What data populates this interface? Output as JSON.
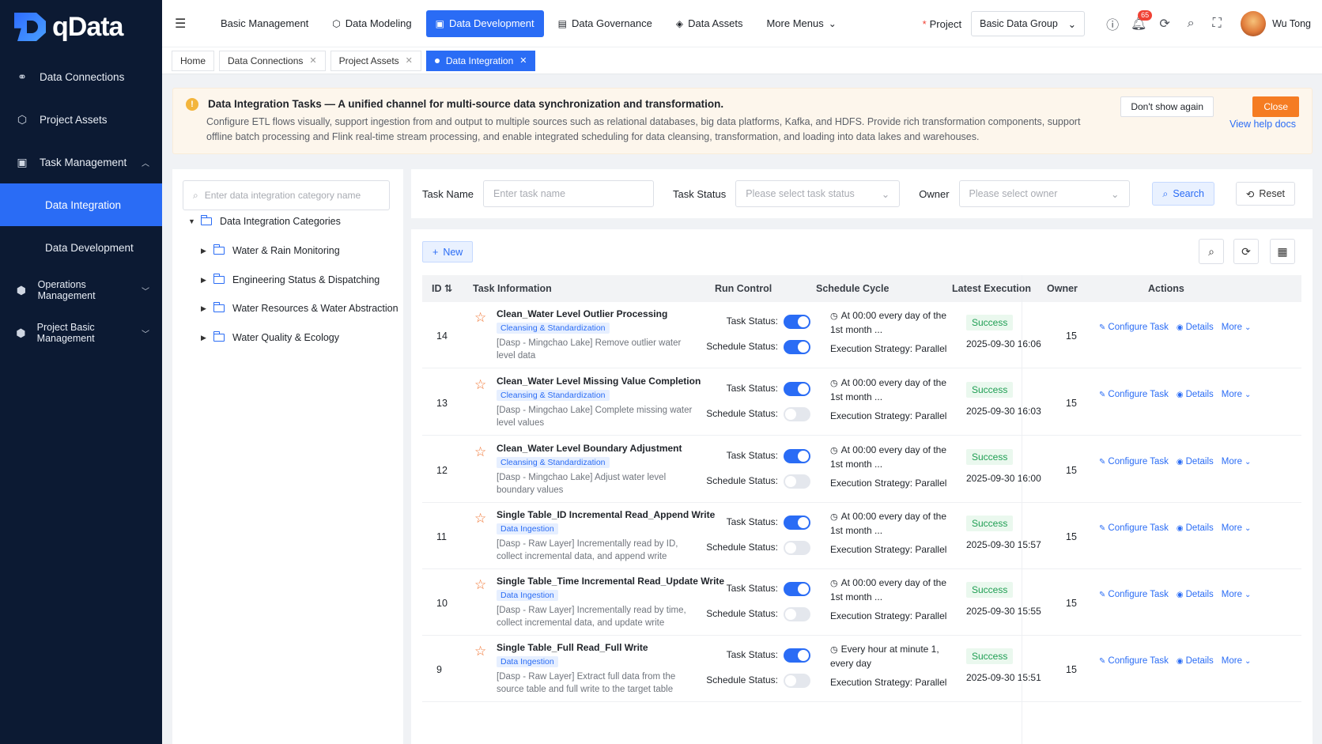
{
  "app": {
    "logo_text": "qData"
  },
  "sidebar": {
    "items": [
      {
        "label": "Data Connections",
        "icon": "connections-icon"
      },
      {
        "label": "Project Assets",
        "icon": "assets-icon"
      },
      {
        "label": "Task Management",
        "icon": "task-icon",
        "expanded": true,
        "children": [
          {
            "label": "Data Integration",
            "active": true
          },
          {
            "label": "Data Development"
          }
        ]
      },
      {
        "label": "Operations Management",
        "icon": "operations-icon"
      },
      {
        "label": "Project Basic Management",
        "icon": "project-icon"
      }
    ]
  },
  "topnav": {
    "items": [
      {
        "label": "Basic Management"
      },
      {
        "label": "Data Modeling",
        "icon": "modeling-icon"
      },
      {
        "label": "Data Development",
        "icon": "development-icon",
        "active": true
      },
      {
        "label": "Data Governance",
        "icon": "governance-icon"
      },
      {
        "label": "Data Assets",
        "icon": "data-assets-icon"
      },
      {
        "label": "More Menus"
      }
    ],
    "project_label": "Project",
    "project_value": "Basic Data Group",
    "notification_count": "65",
    "user_name": "Wu Tong"
  },
  "tabs": [
    {
      "label": "Home"
    },
    {
      "label": "Data Connections"
    },
    {
      "label": "Project Assets"
    },
    {
      "label": "Data Integration",
      "active": true
    }
  ],
  "notice": {
    "title": "Data Integration Tasks — A unified channel for multi-source data synchronization and transformation.",
    "description": "Configure ETL flows visually, support ingestion from and output to multiple sources such as relational databases, big data platforms, Kafka, and HDFS. Provide rich transformation components, support offline batch processing and Flink real-time stream processing, and enable integrated scheduling for data cleansing, transformation, and loading into data lakes and warehouses.",
    "dont_show": "Don't show again",
    "close": "Close",
    "help": "View help docs"
  },
  "tree": {
    "search_placeholder": "Enter data integration category name",
    "root": "Data Integration Categories",
    "children": [
      "Water & Rain Monitoring",
      "Engineering Status & Dispatching",
      "Water Resources & Water Abstraction",
      "Water Quality & Ecology"
    ]
  },
  "filters": {
    "task_name_label": "Task Name",
    "task_name_placeholder": "Enter task name",
    "task_status_label": "Task Status",
    "task_status_placeholder": "Please select task status",
    "owner_label": "Owner",
    "owner_placeholder": "Please select owner",
    "search": "Search",
    "reset": "Reset"
  },
  "toolbar": {
    "new_label": "New"
  },
  "table": {
    "headers": {
      "id": "ID",
      "info": "Task Information",
      "run": "Run Control",
      "schedule": "Schedule Cycle",
      "latest": "Latest Execution",
      "owner": "Owner",
      "actions": "Actions"
    },
    "labels": {
      "task_status": "Task Status:",
      "schedule_status": "Schedule Status:",
      "strategy": "Execution Strategy: Parallel",
      "configure": "Configure Task",
      "details": "Details",
      "more": "More"
    },
    "rows": [
      {
        "id": "14",
        "name": "Clean_Water Level Outlier Processing",
        "tag": "Cleansing & Standardization",
        "desc": "[Dasp - Mingchao Lake] Remove outlier water level data",
        "task_on": true,
        "sched_on": true,
        "schedule": "At 00:00 every day of the 1st month ...",
        "status": "Success",
        "time": "2025-09-30 16:06",
        "owner": "15"
      },
      {
        "id": "13",
        "name": "Clean_Water Level Missing Value Completion",
        "tag": "Cleansing & Standardization",
        "desc": "[Dasp - Mingchao Lake] Complete missing water level values",
        "task_on": true,
        "sched_on": false,
        "schedule": "At 00:00 every day of the 1st month ...",
        "status": "Success",
        "time": "2025-09-30 16:03",
        "owner": "15"
      },
      {
        "id": "12",
        "name": "Clean_Water Level Boundary Adjustment",
        "tag": "Cleansing & Standardization",
        "desc": "[Dasp - Mingchao Lake] Adjust water level boundary values",
        "task_on": true,
        "sched_on": false,
        "schedule": "At 00:00 every day of the 1st month ...",
        "status": "Success",
        "time": "2025-09-30 16:00",
        "owner": "15"
      },
      {
        "id": "11",
        "name": "Single Table_ID Incremental Read_Append Write",
        "tag": "Data Ingestion",
        "desc": "[Dasp - Raw Layer] Incrementally read by ID, collect incremental data, and append write",
        "task_on": true,
        "sched_on": false,
        "schedule": "At 00:00 every day of the 1st month ...",
        "status": "Success",
        "time": "2025-09-30 15:57",
        "owner": "15"
      },
      {
        "id": "10",
        "name": "Single Table_Time Incremental Read_Update Write",
        "tag": "Data Ingestion",
        "desc": "[Dasp - Raw Layer] Incrementally read by time, collect incremental data, and update write",
        "task_on": true,
        "sched_on": false,
        "schedule": "At 00:00 every day of the 1st month ...",
        "status": "Success",
        "time": "2025-09-30 15:55",
        "owner": "15"
      },
      {
        "id": "9",
        "name": "Single Table_Full Read_Full Write",
        "tag": "Data Ingestion",
        "desc": "[Dasp - Raw Layer] Extract full data from the source table and full write to the target table",
        "task_on": true,
        "sched_on": false,
        "schedule": "Every hour at minute 1, every day",
        "status": "Success",
        "time": "2025-09-30 15:51",
        "owner": "15"
      }
    ]
  }
}
